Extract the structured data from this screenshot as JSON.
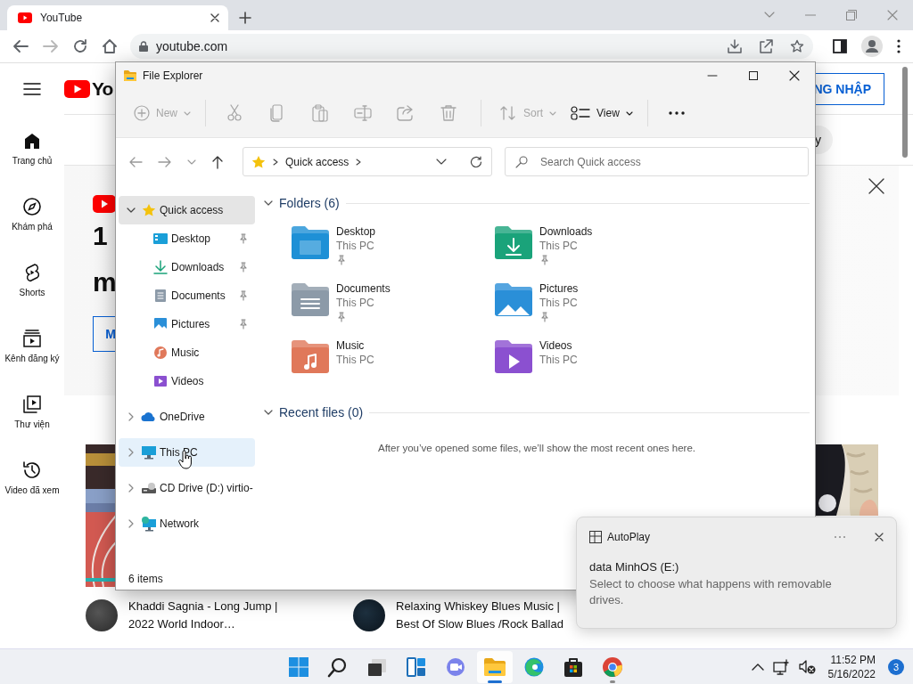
{
  "browser": {
    "tab": {
      "title": "YouTube"
    },
    "address": "youtube.com"
  },
  "youtube": {
    "logo_text": "Yo",
    "sign_in": "NG NHẬP",
    "chip": "y",
    "sidebar": [
      {
        "label": "Trang chủ"
      },
      {
        "label": "Khám phá"
      },
      {
        "label": "Shorts"
      },
      {
        "label": "Kênh đăng ký"
      },
      {
        "label": "Thư viện"
      },
      {
        "label": "Video đã xem"
      }
    ],
    "banner": {
      "line_1": "1",
      "line_2": "m",
      "button": "M"
    },
    "videos": [
      {
        "title_lines": [
          "Khaddi Sagnia - Long Jump |",
          "2022 World Indoor…"
        ]
      },
      {
        "title_lines": [
          "Relaxing Whiskey Blues Music |",
          "Best Of Slow Blues /Rock Ballad"
        ]
      }
    ]
  },
  "file_explorer": {
    "title": "File Explorer",
    "toolbar": [
      {
        "kind": "button",
        "label": "New",
        "disabled": true
      },
      {
        "kind": "separator"
      },
      {
        "kind": "icon",
        "disabled": true
      },
      {
        "kind": "icon",
        "disabled": true
      },
      {
        "kind": "icon",
        "disabled": true
      },
      {
        "kind": "icon",
        "disabled": true
      },
      {
        "kind": "icon",
        "disabled": true
      },
      {
        "kind": "icon",
        "disabled": true
      },
      {
        "kind": "separator"
      },
      {
        "kind": "button",
        "label": "Sort",
        "disabled": true
      },
      {
        "kind": "button",
        "label": "View",
        "disabled": false
      },
      {
        "kind": "separator"
      },
      {
        "kind": "icon",
        "disabled": false
      }
    ],
    "address": {
      "path": "Quick access"
    },
    "search": {
      "placeholder": "Search Quick access"
    },
    "nav": [
      {
        "label": "Quick access",
        "expanded": true,
        "selected": true,
        "hovered": false,
        "children": [
          {
            "label": "Desktop",
            "pinned": true,
            "selected": false,
            "hovered": false
          },
          {
            "label": "Downloads",
            "pinned": true,
            "selected": false,
            "hovered": false
          },
          {
            "label": "Documents",
            "pinned": true,
            "selected": false,
            "hovered": false
          },
          {
            "label": "Pictures",
            "pinned": true,
            "selected": false,
            "hovered": false
          },
          {
            "label": "Music",
            "pinned": false,
            "selected": false,
            "hovered": false
          },
          {
            "label": "Videos",
            "pinned": false,
            "selected": false,
            "hovered": false
          }
        ]
      },
      {
        "label": "OneDrive",
        "expanded": false,
        "selected": false,
        "hovered": false
      },
      {
        "label": "This PC",
        "expanded": false,
        "selected": false,
        "hovered": true
      },
      {
        "label": "CD Drive (D:) virtio-",
        "expanded": false,
        "selected": false,
        "hovered": false
      },
      {
        "label": "Network",
        "expanded": false,
        "selected": false,
        "hovered": false
      }
    ],
    "sections": [
      {
        "title": "Folders (6)",
        "expanded": true,
        "folders": [
          {
            "name": "Desktop",
            "location": "This PC",
            "pinned": true
          },
          {
            "name": "Downloads",
            "location": "This PC",
            "pinned": true
          },
          {
            "name": "Documents",
            "location": "This PC",
            "pinned": true
          },
          {
            "name": "Pictures",
            "location": "This PC",
            "pinned": true
          },
          {
            "name": "Music",
            "location": "This PC",
            "pinned": false
          },
          {
            "name": "Videos",
            "location": "This PC",
            "pinned": false
          }
        ]
      },
      {
        "title": "Recent files (0)",
        "expanded": true,
        "empty_message": "After you’ve opened some files, we’ll show the most recent ones here."
      }
    ],
    "status": "6 items"
  },
  "toast": {
    "app": "AutoPlay",
    "title": "data MinhOS (E:)",
    "message": "Select to choose what happens with removable drives."
  },
  "taskbar": {
    "apps": [
      {
        "active": false,
        "open": false
      },
      {
        "active": false,
        "open": false
      },
      {
        "active": false,
        "open": false
      },
      {
        "active": false,
        "open": false
      },
      {
        "active": false,
        "open": false
      },
      {
        "active": true,
        "open": true
      },
      {
        "active": false,
        "open": false
      },
      {
        "active": false,
        "open": false
      },
      {
        "active": false,
        "open": true
      }
    ],
    "time": "11:52 PM",
    "date": "5/16/2022",
    "notifications": "3"
  }
}
